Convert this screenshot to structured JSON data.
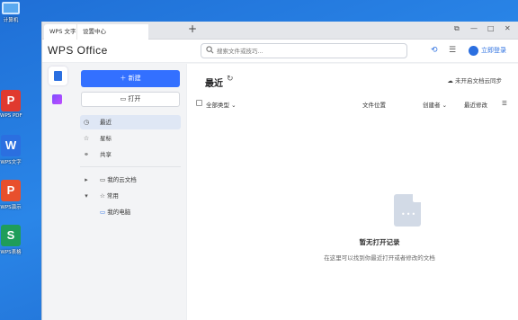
{
  "desktop": {
    "computer_label": "计算机",
    "icons": [
      {
        "letter": "P",
        "label": "WPS PDF",
        "color": "#e03a2f"
      },
      {
        "letter": "W",
        "label": "WPS文字",
        "color": "#2b6fe0"
      },
      {
        "letter": "P",
        "label": "WPS演示",
        "color": "#e8502d"
      },
      {
        "letter": "S",
        "label": "WPS表格",
        "color": "#1f9d5a"
      }
    ]
  },
  "tabs": [
    {
      "label": "WPS 文字"
    },
    {
      "label": "设置中心"
    }
  ],
  "new_tab_symbol": "+",
  "window_controls": [
    "⧉",
    "—",
    "□",
    "✕"
  ],
  "header": {
    "logo": "WPS Office",
    "search_placeholder": "搜索文件或技巧...",
    "login_label": "立即登录"
  },
  "sidebar": {
    "new_label": "新建",
    "open_label": "打开",
    "nav": [
      {
        "label": "最近",
        "icon": "clock-icon",
        "glyph": "◷",
        "active": true
      },
      {
        "label": "星标",
        "icon": "star-icon",
        "glyph": "☆",
        "active": false
      },
      {
        "label": "共享",
        "icon": "share-icon",
        "glyph": "⚭",
        "active": false
      }
    ],
    "tree": [
      {
        "label": "我的云文档",
        "glyph": "▸"
      },
      {
        "label": "常用",
        "glyph": "▾"
      },
      {
        "label": "我的电脑",
        "glyph": ""
      }
    ]
  },
  "main": {
    "title": "最近",
    "sync_label": "未开启文档云同步",
    "columns": {
      "type": "全部类型",
      "location": "文件位置",
      "creator": "创建者",
      "modified": "最近修改"
    },
    "empty_title": "暂无打开记录",
    "empty_subtitle": "在这里可以找到你最近打开或者修改的文档"
  },
  "colors": {
    "accent": "#3370ff",
    "active_nav": "#dfe7f5"
  }
}
